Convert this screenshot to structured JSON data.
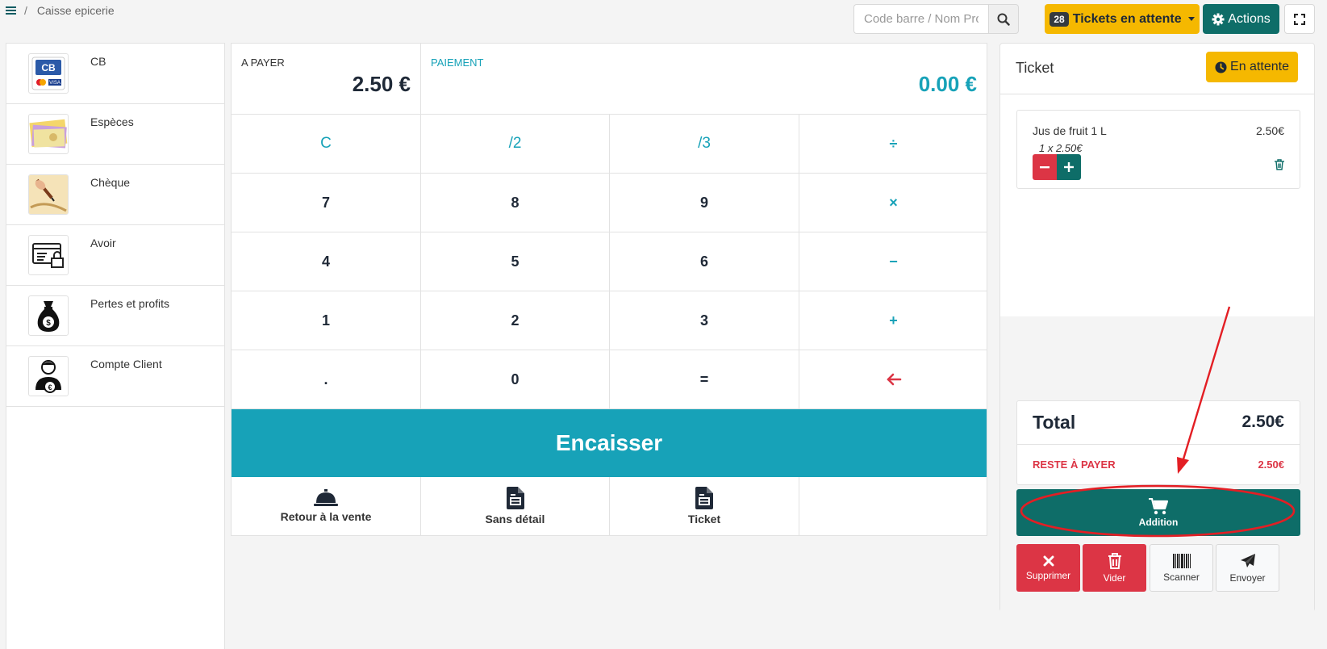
{
  "breadcrumb": {
    "separator": "/",
    "current": "Caisse epicerie"
  },
  "header": {
    "search_placeholder": "Code barre / Nom Produit",
    "tickets_count": "28",
    "tickets_label": "Tickets en attente",
    "actions_label": "Actions"
  },
  "payment_methods": [
    {
      "label": "CB",
      "icon": "credit-card-cb-icon"
    },
    {
      "label": "Espèces",
      "icon": "banknotes-icon"
    },
    {
      "label": "Chèque",
      "icon": "cheque-pen-icon"
    },
    {
      "label": "Avoir",
      "icon": "voucher-lock-icon"
    },
    {
      "label": "Pertes et profits",
      "icon": "money-bag-icon"
    },
    {
      "label": "Compte Client",
      "icon": "customer-account-icon"
    }
  ],
  "amounts": {
    "to_pay_label": "A PAYER",
    "to_pay_value": "2.50  €",
    "paid_label": "PAIEMENT",
    "paid_value": "0.00  €"
  },
  "keypad": {
    "row1": [
      "C",
      "/2",
      "/3",
      "÷"
    ],
    "row2": [
      "7",
      "8",
      "9",
      "×"
    ],
    "row3": [
      "4",
      "5",
      "6",
      "−"
    ],
    "row4": [
      "1",
      "2",
      "3",
      "+"
    ],
    "row5": [
      ".",
      "0",
      "=",
      "←"
    ]
  },
  "encaisser_label": "Encaisser",
  "bottom_actions": {
    "back": "Retour à la vente",
    "no_detail": "Sans détail",
    "ticket": "Ticket"
  },
  "ticket": {
    "title": "Ticket",
    "on_hold_label": "En attente",
    "lines": [
      {
        "name": "Jus de fruit 1 L",
        "price": "2.50€",
        "detail": "1 x 2.50€"
      }
    ],
    "total_label": "Total",
    "total_value": "2.50€",
    "remaining_label": "RESTE À PAYER",
    "remaining_value": "2.50€",
    "addition_label": "Addition",
    "actions": {
      "delete": "Supprimer",
      "empty": "Vider",
      "scan": "Scanner",
      "send": "Envoyer"
    }
  },
  "colors": {
    "teal": "#0e6d68",
    "cyan": "#17a2b8",
    "yellow": "#f5b800",
    "red": "#dc3545",
    "annotation_red": "#e31e24"
  }
}
